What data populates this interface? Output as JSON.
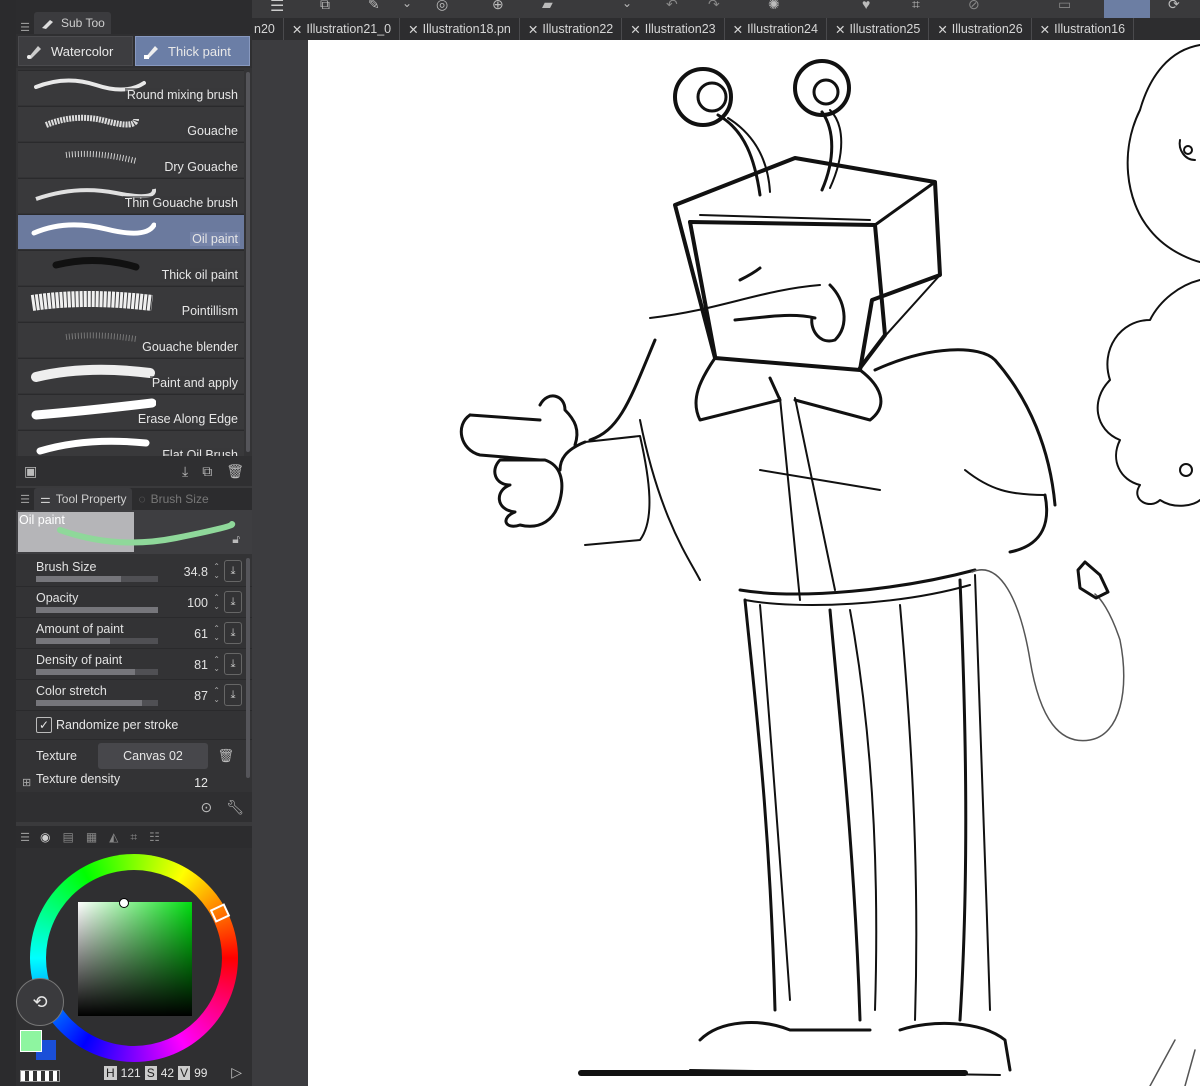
{
  "sub_tool_panel": {
    "tab_label": "Sub Too",
    "categories": [
      {
        "label": "Watercolor",
        "selected": false
      },
      {
        "label": "Thick paint",
        "selected": true
      }
    ],
    "brushes": [
      {
        "label": "Round mixing brush",
        "selected": false
      },
      {
        "label": "Gouache",
        "selected": false
      },
      {
        "label": "Dry Gouache",
        "selected": false
      },
      {
        "label": "Thin Gouache brush",
        "selected": false
      },
      {
        "label": "Oil paint",
        "selected": true
      },
      {
        "label": "Thick oil paint",
        "selected": false
      },
      {
        "label": "Pointillism",
        "selected": false
      },
      {
        "label": "Gouache blender",
        "selected": false
      },
      {
        "label": "Paint and apply",
        "selected": false
      },
      {
        "label": "Erase Along Edge",
        "selected": false
      },
      {
        "label": "Flat Oil Brush",
        "selected": false
      }
    ]
  },
  "tool_property_panel": {
    "tab_label": "Tool Property",
    "tab2_label": "Brush Size",
    "preview_label": "Oil paint",
    "props": [
      {
        "label": "Brush Size",
        "value": "34.8",
        "fill": 0.7
      },
      {
        "label": "Opacity",
        "value": "100",
        "fill": 1.0
      },
      {
        "label": "Amount of paint",
        "value": "61",
        "fill": 0.61
      },
      {
        "label": "Density of paint",
        "value": "81",
        "fill": 0.81
      },
      {
        "label": "Color stretch",
        "value": "87",
        "fill": 0.87
      }
    ],
    "randomize_label": "Randomize per stroke",
    "randomize_checked": true,
    "texture_label": "Texture",
    "texture_value": "Canvas 02",
    "texture_density_label": "Texture density",
    "texture_density_value": "12"
  },
  "color_panel": {
    "h_label": "H",
    "h_value": "121",
    "s_label": "S",
    "s_value": "42",
    "v_label": "V",
    "v_value": "99",
    "main_color": "#8ef5a0",
    "sub_color": "#1a4fd8"
  },
  "tabs": [
    {
      "label": "n20"
    },
    {
      "label": "Illustration21_0"
    },
    {
      "label": "Illustration18.pn"
    },
    {
      "label": "Illustration22"
    },
    {
      "label": "Illustration23"
    },
    {
      "label": "Illustration24"
    },
    {
      "label": "Illustration25"
    },
    {
      "label": "Illustration26"
    },
    {
      "label": "Illustration16"
    }
  ]
}
